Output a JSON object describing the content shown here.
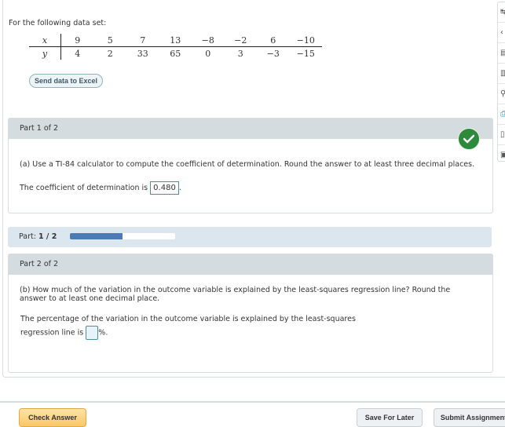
{
  "intro_text": "For the following data set:",
  "data_table": {
    "x_label": "x",
    "y_label": "y",
    "x_values": [
      "9",
      "5",
      "7",
      "13",
      "−8",
      "−2",
      "6",
      "−10"
    ],
    "y_values": [
      "4",
      "2",
      "33",
      "65",
      "0",
      "3",
      "−3",
      "−15"
    ]
  },
  "send_to_excel_label": "Send data to Excel",
  "part1": {
    "header": "Part 1 of 2",
    "question": "(a) Use a TI-84 calculator to compute the coefficient of determination. Round the answer to at least three decimal places.",
    "answer_prefix": "The coefficient of determination is",
    "answer_value": "0.480",
    "answer_suffix": ".",
    "status": "correct"
  },
  "progress": {
    "label": "Part:",
    "value_text": "1 / 2",
    "fraction": 0.5,
    "color": "#4a7bb7"
  },
  "part2": {
    "header": "Part 2 of 2",
    "question": "(b) How much of the variation in the outcome variable is explained by the least-squares regression line? Round the answer to at least one decimal place.",
    "answer_line1": "The percentage of the variation in the outcome variable is explained by the least-squares",
    "answer_prefix": "regression line is",
    "answer_value": "",
    "answer_suffix": "%."
  },
  "footer": {
    "check_answer": "Check Answer",
    "save_for_later": "Save For Later",
    "submit_assignment": "Submit Assignment"
  },
  "toolbar": {
    "icons": [
      "expand-icon",
      "collapse-icon",
      "notes-icon",
      "calculator-icon",
      "search-icon",
      "print-icon",
      "reference-icon",
      "textbook-icon"
    ]
  }
}
